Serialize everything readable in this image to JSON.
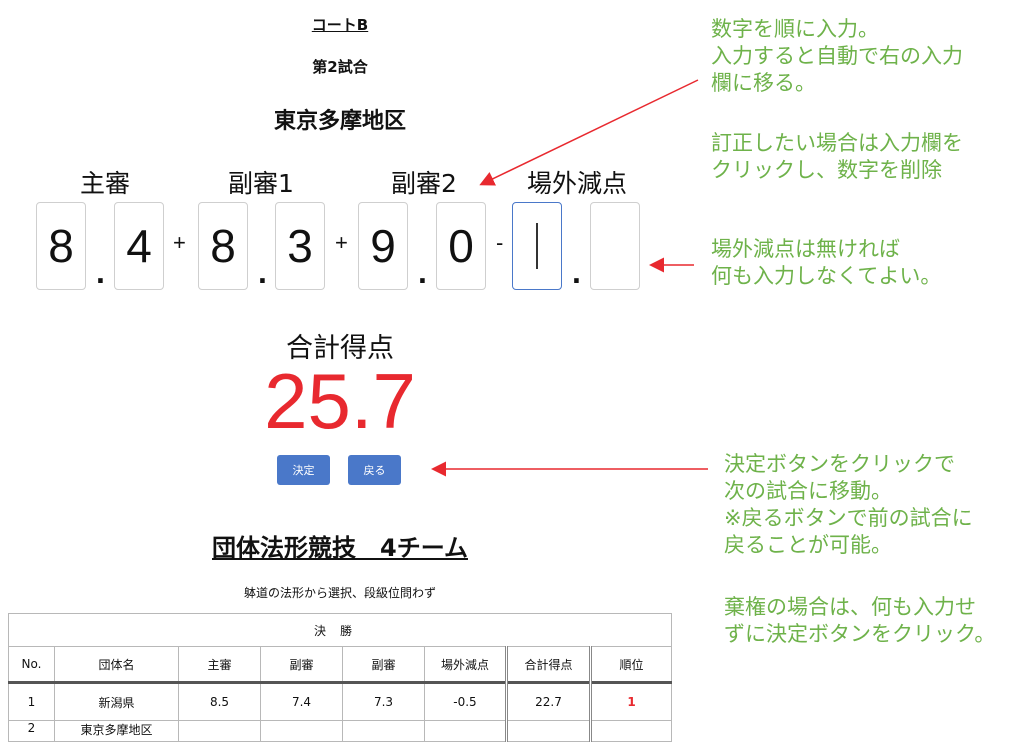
{
  "header": {
    "court": "コートB",
    "match": "第2試合",
    "team": "東京多摩地区"
  },
  "judges": {
    "chief": "主審",
    "sub1": "副審1",
    "sub2": "副審2",
    "deduction": "場外減点"
  },
  "scores": {
    "chief_int": "8",
    "chief_dec": "4",
    "sub1_int": "8",
    "sub1_dec": "3",
    "sub2_int": "9",
    "sub2_dec": "0",
    "ded_int": "",
    "ded_dec": "",
    "plus": "+",
    "minus": "-",
    "dot": "."
  },
  "total": {
    "label": "合計得点",
    "value": "25.7"
  },
  "buttons": {
    "decide": "決定",
    "back": "戻る"
  },
  "event": {
    "title": "団体法形競技　4チーム",
    "note": "躰道の法形から選択、段級位問わず"
  },
  "table": {
    "section": "決勝",
    "columns": [
      "No.",
      "団体名",
      "主審",
      "副審",
      "副審",
      "場外減点",
      "合計得点",
      "順位"
    ],
    "rows": [
      [
        "1",
        "新潟県",
        "8.5",
        "7.4",
        "7.3",
        "-0.5",
        "22.7",
        "1"
      ],
      [
        "2",
        "東京多摩地区",
        "",
        "",
        "",
        "",
        "",
        ""
      ]
    ]
  },
  "annotations": {
    "input_order": "数字を順に入力。\n入力すると自動で右の入力\n欄に移る。",
    "correction": "訂正したい場合は入力欄を\nクリックし、数字を削除",
    "deduction_hint": "場外減点は無ければ\n何も入力しなくてよい。",
    "decide_hint": "決定ボタンをクリックで\n次の試合に移動。\n※戻るボタンで前の試合に\n戻ることが可能。",
    "forfeit_hint": "棄権の場合は、何も入力せ\nずに決定ボタンをクリック。"
  },
  "colors": {
    "accent": "#4a78c9",
    "total": "#e8292f",
    "annotation": "#6eb24a",
    "arrow": "#e8292f"
  }
}
